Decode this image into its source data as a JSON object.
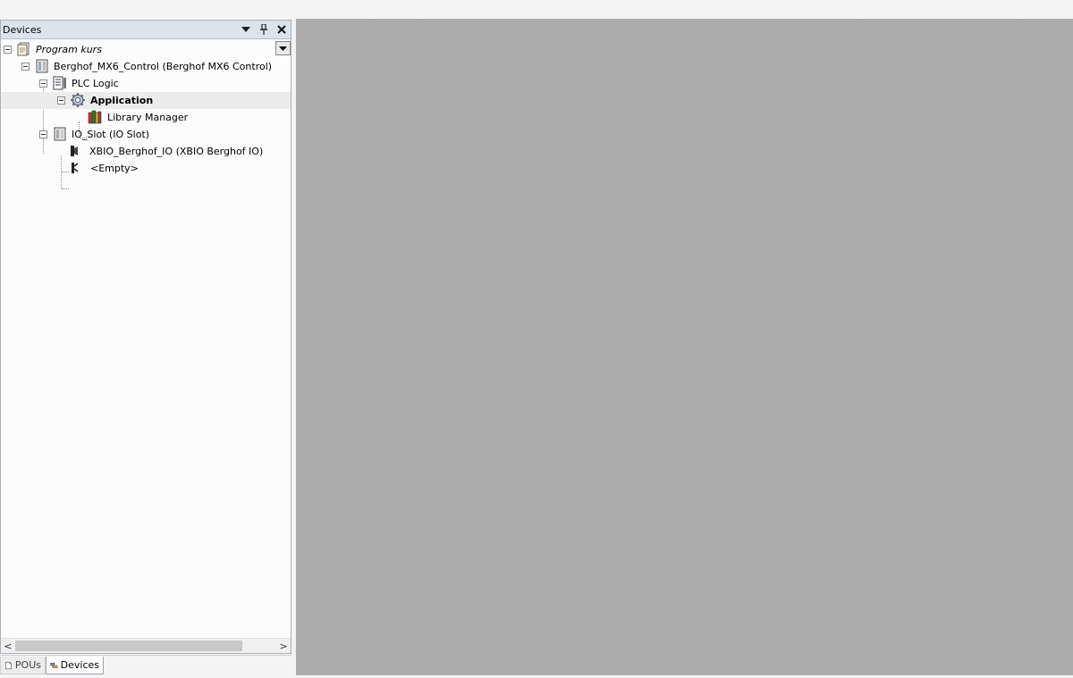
{
  "panel": {
    "title": "Devices",
    "buttons": {
      "dropdown": "▾",
      "pin": "⊥",
      "close": "✕"
    }
  },
  "tree": {
    "nodes": [
      {
        "label": "Program kurs",
        "icon": "project-icon",
        "italic": true
      },
      {
        "label": "Berghof_MX6_Control (Berghof MX6 Control)",
        "icon": "device-icon"
      },
      {
        "label": "PLC Logic",
        "icon": "plc-logic-icon"
      },
      {
        "label": "Application",
        "icon": "application-gear-icon",
        "bold": true
      },
      {
        "label": "Library Manager",
        "icon": "library-manager-icon"
      },
      {
        "label": "IO_Slot (IO Slot)",
        "icon": "io-slot-icon"
      },
      {
        "label": "XBIO_Berghof_IO (XBIO Berghof IO)",
        "icon": "io-module-icon"
      },
      {
        "label": "<Empty>",
        "icon": "empty-slot-icon"
      }
    ]
  },
  "tabs": [
    {
      "label": "POUs",
      "icon": "pous-icon",
      "active": false
    },
    {
      "label": "Devices",
      "icon": "devices-icon",
      "active": true
    }
  ],
  "scrollbar": {
    "left_arrow": "<",
    "right_arrow": ">"
  },
  "colors": {
    "panel_header": "#dde3ea",
    "editor_background": "#aaaaaa",
    "selected_row": "#ececec"
  }
}
